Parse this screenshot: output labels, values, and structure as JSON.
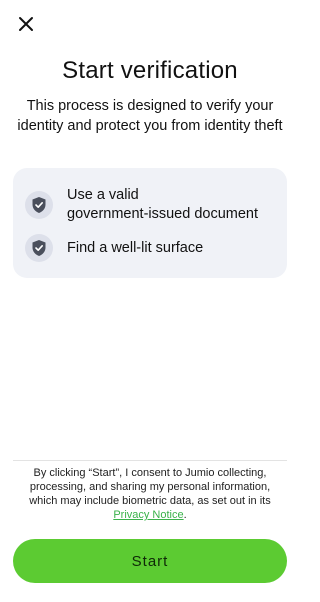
{
  "header": {
    "close_icon": "close-icon",
    "title": "Start verification",
    "subtitle": "This process is designed to verify your identity and protect you from identity theft"
  },
  "requirements": {
    "icon": "shield-check-icon",
    "items": [
      {
        "label_line1": "Use a valid",
        "label_line2": "government-issued document"
      },
      {
        "label_line1": "Find a well-lit surface"
      }
    ]
  },
  "consent": {
    "text": "By clicking “Start”, I consent to Jumio collecting, processing, and sharing my personal information, which may include biometric data, as set out in its",
    "link_label": "Privacy Notice",
    "suffix": "."
  },
  "footer": {
    "start_label": "Start"
  },
  "colors": {
    "accent_green": "#5ccb32",
    "link_green": "#3ab24a",
    "card_bg": "#f0f2f7",
    "shield_dark": "#4a4f5c"
  }
}
